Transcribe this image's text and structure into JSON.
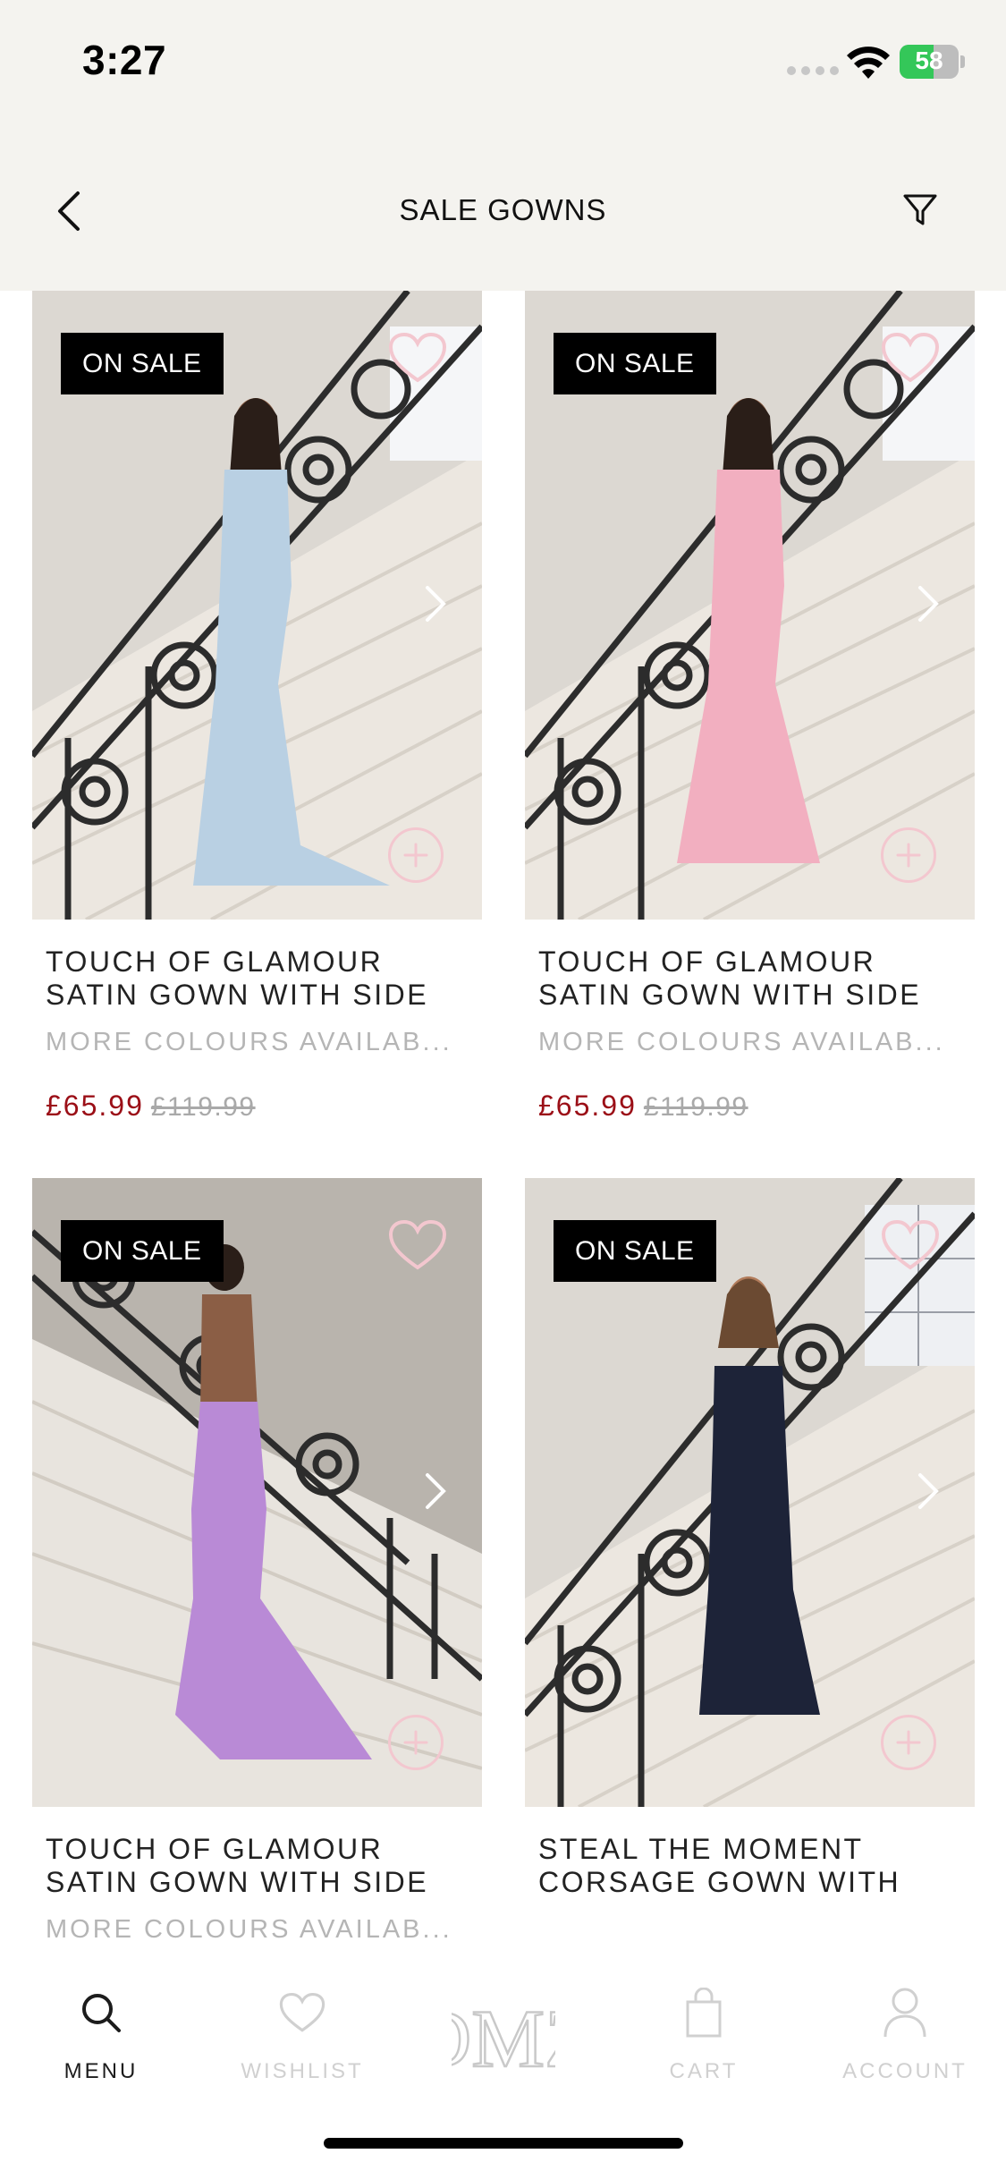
{
  "status_bar": {
    "time": "3:27",
    "battery": "58",
    "battery_level": 0.58
  },
  "nav": {
    "title": "SALE GOWNS"
  },
  "products": [
    {
      "badge": "ON SALE",
      "name": "TOUCH OF GLAMOUR SATIN GOWN WITH SIDE",
      "colours": "MORE COLOURS AVAILAB...",
      "price": "£65.99",
      "was_price": "£119.99",
      "dress_color": "#b9d0e3"
    },
    {
      "badge": "ON SALE",
      "name": "TOUCH OF GLAMOUR SATIN GOWN WITH SIDE",
      "colours": "MORE COLOURS AVAILAB...",
      "price": "£65.99",
      "was_price": "£119.99",
      "dress_color": "#f2afc0"
    },
    {
      "badge": "ON SALE",
      "name": "TOUCH OF GLAMOUR SATIN GOWN WITH SIDE",
      "colours": "MORE COLOURS AVAILAB...",
      "price": "",
      "was_price": "",
      "dress_color": "#b98ad6"
    },
    {
      "badge": "ON SALE",
      "name": "STEAL THE MOMENT CORSAGE GOWN WITH",
      "colours": "",
      "price": "",
      "was_price": "",
      "dress_color": "#1d2338"
    }
  ],
  "tab_bar": {
    "menu": "MENU",
    "wishlist": "WISHLIST",
    "cart": "CART",
    "account": "ACCOUNT",
    "logo_text": "DMZ"
  },
  "colors": {
    "sale_price": "#9b0f17",
    "nav_bg": "#f4f3ef",
    "badge_bg": "#000000",
    "heart": "#f3c7cf"
  },
  "icons": [
    "back-arrow-icon",
    "filter-icon",
    "heart-icon",
    "plus-icon",
    "chevron-right-icon",
    "search-icon",
    "shopping-bag-icon",
    "user-icon"
  ]
}
